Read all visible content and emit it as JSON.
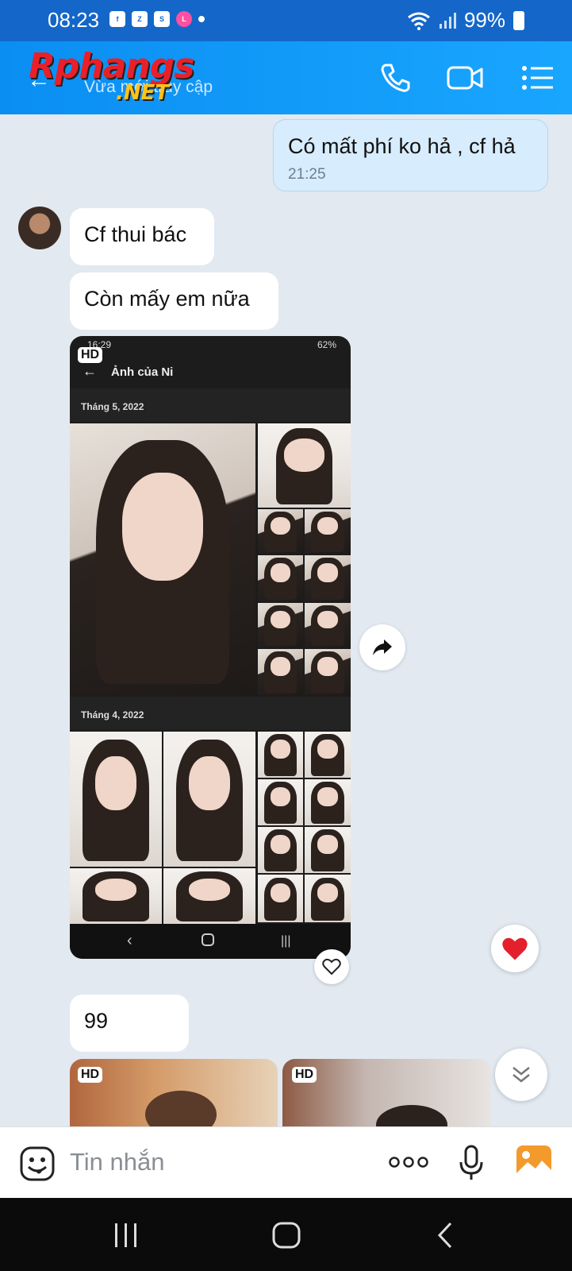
{
  "status_bar": {
    "time": "08:23",
    "app_icons": [
      "facebook-icon",
      "zalo-icon",
      "shopee-icon",
      "lazada-icon"
    ],
    "battery": "99%"
  },
  "header": {
    "logo_text_1": "Rphangs",
    "logo_text_2": ".NET",
    "subtitle": "Vừa mới truy cập",
    "brand_color": "#0a8ef2"
  },
  "messages": {
    "m1": {
      "text": "Có mất phí ko hả , cf hả",
      "time": "21:25"
    },
    "m2": {
      "text": "Cf thui bác"
    },
    "m3": {
      "text": "Còn mấy em nữa"
    },
    "image": {
      "hd_label": "HD",
      "shot_time": "16:29",
      "shot_battery": "62%",
      "shot_title": "Ảnh của Ni",
      "month1": "Tháng 5, 2022",
      "month2": "Tháng 4, 2022"
    },
    "m4": {
      "text": "99"
    },
    "thumb_hd_1": "HD",
    "thumb_hd_2": "HD"
  },
  "composer": {
    "placeholder": "Tin nhắn"
  }
}
